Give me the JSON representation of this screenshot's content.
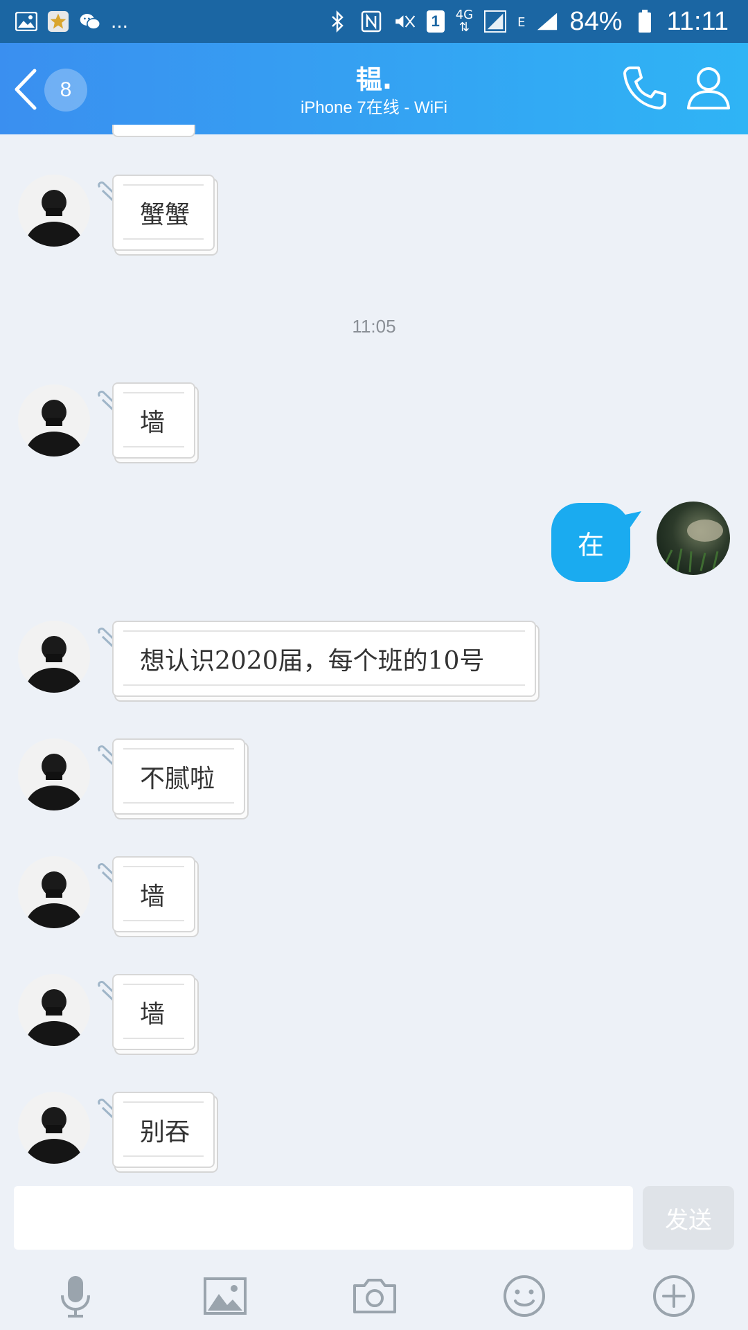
{
  "status_bar": {
    "battery": "84%",
    "time": "11:11",
    "sim_slot": "1",
    "net_4g": "4G",
    "net_e": "E",
    "notif_more": "..."
  },
  "header": {
    "unread_count": "8",
    "title": "韫.",
    "subtitle": "iPhone 7在线 - WiFi"
  },
  "timestamps": [
    "11:05"
  ],
  "messages": [
    {
      "text": "蟹蟹"
    },
    {
      "text": "墙"
    },
    {
      "text": "在"
    },
    {
      "text": "想认识2020届，每个班的10号"
    },
    {
      "text": "不腻啦"
    },
    {
      "text": "墙"
    },
    {
      "text": "墙"
    },
    {
      "text": "别吞"
    }
  ],
  "input": {
    "placeholder": "",
    "send_label": "发送"
  },
  "colors": {
    "header_start": "#3a8ff0",
    "header_end": "#2fb4f5",
    "my_bubble": "#1aabf0",
    "background": "#edf1f7"
  },
  "toolbar_icons": [
    "microphone-icon",
    "image-icon",
    "camera-icon",
    "emoji-icon",
    "plus-icon"
  ]
}
